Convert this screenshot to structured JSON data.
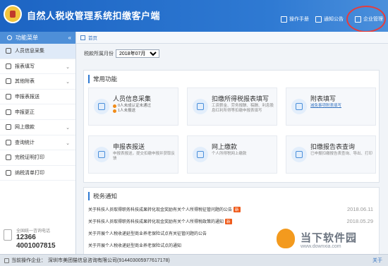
{
  "app": {
    "title": "自然人税收管理系统扣缴客户端"
  },
  "toolbar": {
    "manual": "操作手册",
    "notice": "通知公告",
    "enterprise": "企业管理"
  },
  "sidebar": {
    "header": "功能菜单",
    "items": [
      {
        "label": "人员信息采集",
        "icon": "person-icon",
        "chevron": ""
      },
      {
        "label": "报表填写",
        "icon": "edit-icon",
        "chevron": "⌄"
      },
      {
        "label": "其他附表",
        "icon": "grid-icon",
        "chevron": "⌄"
      },
      {
        "label": "申报表报送",
        "icon": "send-icon",
        "chevron": ""
      },
      {
        "label": "申报更正",
        "icon": "correct-icon",
        "chevron": ""
      },
      {
        "label": "网上缴款",
        "icon": "payment-icon",
        "chevron": "⌄"
      },
      {
        "label": "查询统计",
        "icon": "search-icon",
        "chevron": "⌄"
      },
      {
        "label": "完税证明打印",
        "icon": "print-icon",
        "chevron": ""
      },
      {
        "label": "纳税清单打印",
        "icon": "print-icon",
        "chevron": ""
      }
    ],
    "hotline_label": "全国统一咨询电话",
    "hotline_1": "12366",
    "hotline_2": "4001007815"
  },
  "tabs": {
    "home": "首页"
  },
  "period": {
    "label": "税款所属月份",
    "value": "2018年07月"
  },
  "common": {
    "title": "常用功能",
    "cards": [
      {
        "title": "人员信息采集",
        "badge1": "0人未成认证未通过",
        "badge2": "1人未报送",
        "desc": ""
      },
      {
        "title": "扣缴所得税报表填写",
        "badge1": "",
        "badge2": "",
        "desc": "工资薪金、劳务报酬、稿酬、利息股息红利所得等扣缴申报表填写"
      },
      {
        "title": "附表填写",
        "badge1": "",
        "badge2": "",
        "desc": "减免事项附表填写"
      },
      {
        "title": "申报表报送",
        "badge1": "",
        "badge2": "",
        "desc": "申报表报送，提交扣缴申报并获取反馈"
      },
      {
        "title": "网上缴款",
        "badge1": "",
        "badge2": "",
        "desc": "个人所得税网上缴款"
      },
      {
        "title": "扣缴报告表查询",
        "badge1": "",
        "badge2": "",
        "desc": "已申报扣缴报告表查询、导出、打印"
      }
    ]
  },
  "notices": {
    "title": "税务通知",
    "items": [
      {
        "text": "关于科技人员取得职务科技成果转化现金奖励有关个人所得税征管问题的公告",
        "new": "新",
        "date": "2018.06.11"
      },
      {
        "text": "关于科技人员取得职务科技成果转化现金奖励有关个人所得税政策的通知",
        "new": "新",
        "date": "2018.05.29"
      },
      {
        "text": "关于开展个人税收递延型商业养老保险试点有关征管问题的公告",
        "new": "",
        "date": ""
      },
      {
        "text": "关于开展个人税收递延型商业养老保险试点的通知",
        "new": "",
        "date": ""
      }
    ]
  },
  "status": {
    "label": "当前操作企业：",
    "company": "深圳市美团猫信息咨询有限公司(914403005977617178)",
    "about": "关于"
  },
  "watermark": {
    "line1": "当下软件园",
    "line2": "www.downxia.com"
  },
  "colors": {
    "title_bar": "#2f7ad3",
    "accent": "#2f7ad3",
    "badge_new": "#ef5b1b",
    "annotation_ring": "#e63c3c"
  }
}
